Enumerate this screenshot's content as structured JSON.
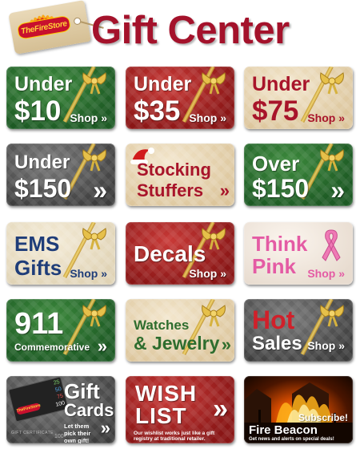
{
  "header": {
    "logo_text": "TheFireStore",
    "title": "Gift Center"
  },
  "tiles": [
    {
      "id": "under10",
      "line1": "Under",
      "line2": "$10",
      "shop": "Shop",
      "chev": "»"
    },
    {
      "id": "under35",
      "line1": "Under",
      "line2": "$35",
      "shop": "Shop",
      "chev": "»"
    },
    {
      "id": "under75",
      "line1": "Under",
      "line2": "$75",
      "shop": "Shop",
      "chev": "»"
    },
    {
      "id": "under150",
      "line1": "Under",
      "line2": "$150",
      "chev": "»"
    },
    {
      "id": "stocking",
      "line1": "Stocking",
      "line2": "Stuffers",
      "chev": "»"
    },
    {
      "id": "over150",
      "line1": "Over",
      "line2": "$150",
      "chev": "»"
    },
    {
      "id": "ems",
      "line1": "EMS",
      "line2": "Gifts",
      "shop": "Shop",
      "chev": "»"
    },
    {
      "id": "decals",
      "line1": "Decals",
      "shop": "Shop",
      "chev": "»"
    },
    {
      "id": "thinkpink",
      "line1": "Think",
      "line2": "Pink",
      "shop": "Shop",
      "chev": "»"
    },
    {
      "id": "911",
      "line1": "911",
      "line2": "Commemorative",
      "chev": "»"
    },
    {
      "id": "watches",
      "line1": "Watches",
      "line2": "& Jewelry",
      "chev": "»"
    },
    {
      "id": "hotsales",
      "line1": "Hot",
      "line2": "Sales",
      "shop": "Shop",
      "chev": "»"
    },
    {
      "id": "giftcards",
      "line1": "Gift",
      "line2": "Cards",
      "sub": "Let them pick their own gift!",
      "chev": "»",
      "card_values": [
        "25",
        "50",
        "75",
        "100"
      ],
      "card_label": "GIFT CERTIFICATE",
      "card_brand": "TheFireStore",
      "card_value": "100"
    },
    {
      "id": "wishlist",
      "line1": "WISH",
      "line2": "LIST",
      "sub": "Our wishlist works just like a gift registry at traditional retailer.",
      "chev": "»"
    },
    {
      "id": "firebeacon",
      "line1": "Subscribe!",
      "line2": "Fire Beacon",
      "sub": "Get news and alerts on special deals!"
    }
  ]
}
